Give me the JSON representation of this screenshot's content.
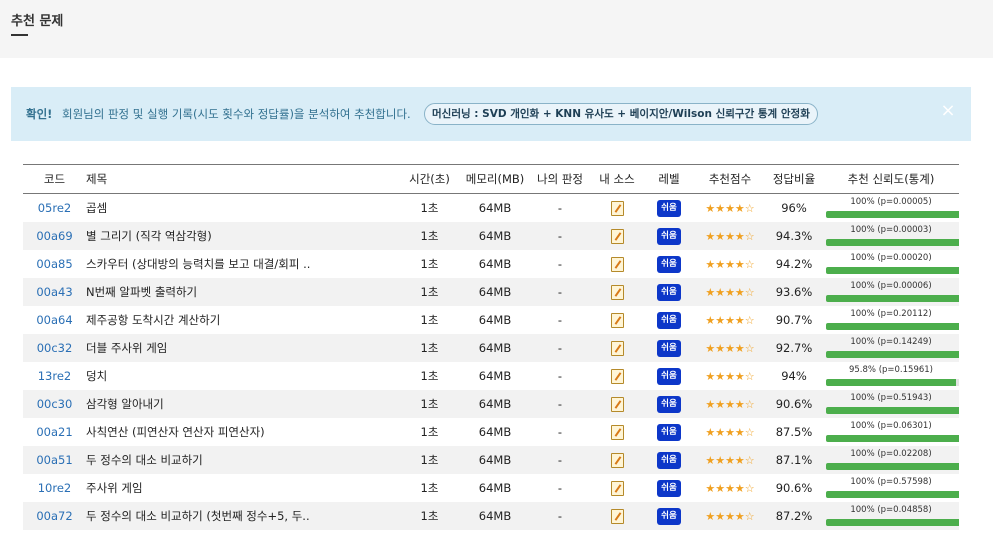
{
  "section": {
    "title": "추천 문제"
  },
  "notice": {
    "strong": "확인!",
    "text": "회원님의 판정 및 실행 기록(시도 횟수와 정답률)을 분석하여 추천합니다.",
    "badge": "머신러닝 : SVD 개인화 + KNN 유사도 + 베이지안/Wilson 신뢰구간 통계 안정화",
    "close": "×"
  },
  "table": {
    "headers": {
      "code": "코드",
      "title": "제목",
      "time": "시간(초)",
      "memory": "메모리(MB)",
      "verdict": "나의 판정",
      "source": "내 소스",
      "level": "레벨",
      "score": "추천점수",
      "ratio": "정답비율",
      "confidence": "추천 신뢰도(통계)"
    },
    "rows": [
      {
        "code": "05re2",
        "title": "곱셈",
        "time": "1초",
        "memory": "64MB",
        "verdict": "-",
        "level": "쉬움",
        "stars": "★★★★☆",
        "ratio": "96%",
        "conf_text": "100% (p=0.00005)",
        "conf": 1.0
      },
      {
        "code": "00a69",
        "title": "별 그리기 (직각 역삼각형)",
        "time": "1초",
        "memory": "64MB",
        "verdict": "-",
        "level": "쉬움",
        "stars": "★★★★☆",
        "ratio": "94.3%",
        "conf_text": "100% (p=0.00003)",
        "conf": 1.0
      },
      {
        "code": "00a85",
        "title": "스카우터 (상대방의 능력치를 보고 대결/회피 ..",
        "time": "1초",
        "memory": "64MB",
        "verdict": "-",
        "level": "쉬움",
        "stars": "★★★★☆",
        "ratio": "94.2%",
        "conf_text": "100% (p=0.00020)",
        "conf": 1.0
      },
      {
        "code": "00a43",
        "title": "N번째 알파벳 출력하기",
        "time": "1초",
        "memory": "64MB",
        "verdict": "-",
        "level": "쉬움",
        "stars": "★★★★☆",
        "ratio": "93.6%",
        "conf_text": "100% (p=0.00006)",
        "conf": 1.0
      },
      {
        "code": "00a64",
        "title": "제주공항 도착시간 계산하기",
        "time": "1초",
        "memory": "64MB",
        "verdict": "-",
        "level": "쉬움",
        "stars": "★★★★☆",
        "ratio": "90.7%",
        "conf_text": "100% (p=0.20112)",
        "conf": 1.0
      },
      {
        "code": "00c32",
        "title": "더블 주사위 게임",
        "time": "1초",
        "memory": "64MB",
        "verdict": "-",
        "level": "쉬움",
        "stars": "★★★★☆",
        "ratio": "92.7%",
        "conf_text": "100% (p=0.14249)",
        "conf": 1.0
      },
      {
        "code": "13re2",
        "title": "덩치",
        "time": "1초",
        "memory": "64MB",
        "verdict": "-",
        "level": "쉬움",
        "stars": "★★★★☆",
        "ratio": "94%",
        "conf_text": "95.8% (p=0.15961)",
        "conf": 0.958
      },
      {
        "code": "00c30",
        "title": "삼각형 알아내기",
        "time": "1초",
        "memory": "64MB",
        "verdict": "-",
        "level": "쉬움",
        "stars": "★★★★☆",
        "ratio": "90.6%",
        "conf_text": "100% (p=0.51943)",
        "conf": 1.0
      },
      {
        "code": "00a21",
        "title": "사칙연산 (피연산자 연산자 피연산자)",
        "time": "1초",
        "memory": "64MB",
        "verdict": "-",
        "level": "쉬움",
        "stars": "★★★★☆",
        "ratio": "87.5%",
        "conf_text": "100% (p=0.06301)",
        "conf": 1.0
      },
      {
        "code": "00a51",
        "title": "두 정수의 대소 비교하기",
        "time": "1초",
        "memory": "64MB",
        "verdict": "-",
        "level": "쉬움",
        "stars": "★★★★☆",
        "ratio": "87.1%",
        "conf_text": "100% (p=0.02208)",
        "conf": 1.0
      },
      {
        "code": "10re2",
        "title": "주사위 게임",
        "time": "1초",
        "memory": "64MB",
        "verdict": "-",
        "level": "쉬움",
        "stars": "★★★★☆",
        "ratio": "90.6%",
        "conf_text": "100% (p=0.57598)",
        "conf": 1.0
      },
      {
        "code": "00a72",
        "title": "두 정수의 대소 비교하기 (첫번째 정수+5, 두..",
        "time": "1초",
        "memory": "64MB",
        "verdict": "-",
        "level": "쉬움",
        "stars": "★★★★☆",
        "ratio": "87.2%",
        "conf_text": "100% (p=0.04858)",
        "conf": 1.0
      }
    ]
  },
  "colors": {
    "accent": "#2a6fb5",
    "badge": "#0d37c9",
    "bar": "#4cae4c",
    "notice_bg": "#d9edf7"
  },
  "icons": {
    "source": "memo-icon",
    "close": "close-icon"
  }
}
